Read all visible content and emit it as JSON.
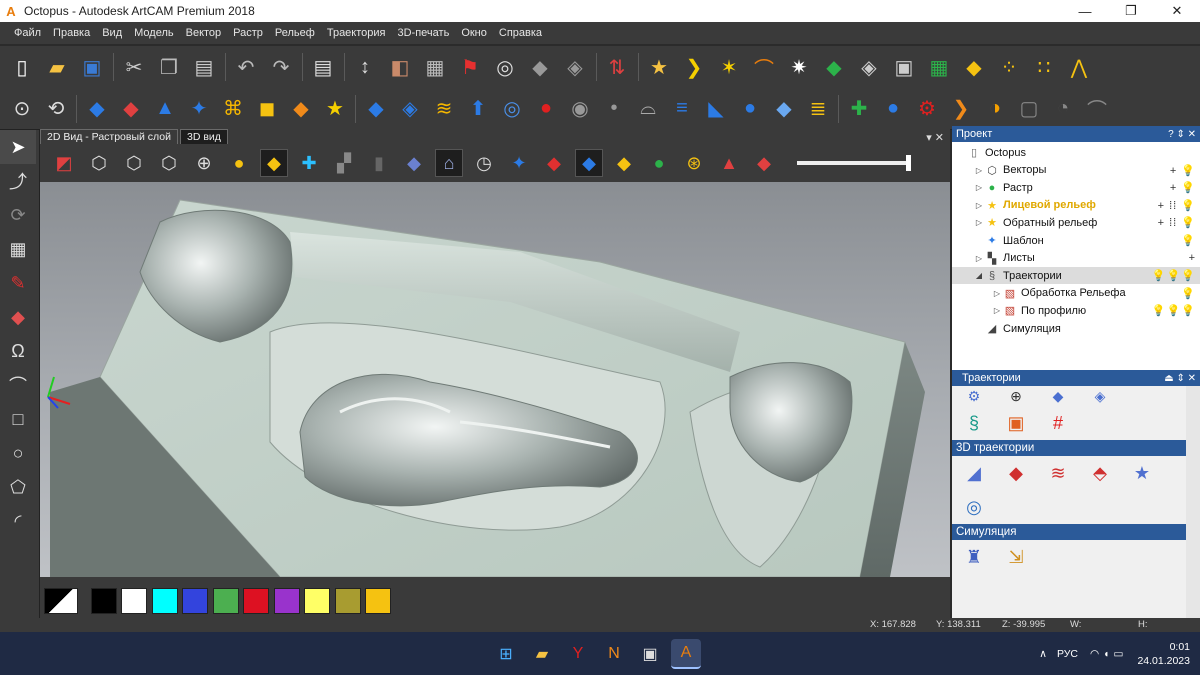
{
  "window": {
    "title": "Octopus - Autodesk ArtCAM Premium 2018",
    "logo_letter": "A",
    "minimize": "—",
    "maximize": "❐",
    "close": "✕"
  },
  "menu": [
    "Файл",
    "Правка",
    "Вид",
    "Модель",
    "Вектор",
    "Растр",
    "Рельеф",
    "Траектория",
    "3D-печать",
    "Окно",
    "Справка"
  ],
  "toolbar1_icons": [
    "new-file-icon",
    "open-folder-icon",
    "save-icon",
    "cut-icon",
    "copy-icon",
    "paste-icon",
    "undo-icon",
    "redo-icon",
    "notes-icon",
    "dimension-icon",
    "split-view-icon",
    "grid-view-icon",
    "flag-icon",
    "measure-icon",
    "fill-icon",
    "relief-icon",
    "distribute-icon",
    "folder-star-icon",
    "path-icon",
    "sparkle-icon",
    "curve-icon",
    "star-burst-icon",
    "green-tile-icon",
    "blend-icon",
    "frame-icon",
    "green-grid-icon",
    "yellow-tile-icon",
    "dots-icon",
    "dotted-line-icon",
    "node-chain-icon"
  ],
  "toolbar2_icons": [
    "zoom-fit-icon",
    "rotate-icon",
    "blue-diamond-icon",
    "red-tile-icon",
    "blue-pyramid-icon",
    "blue-star-icon",
    "gold-weave-icon",
    "yellow-box-icon",
    "orange-dots-icon",
    "star-page-icon",
    "blue-plane-icon",
    "blue-split-icon",
    "gold-stripes-icon",
    "blue-arrow-icon",
    "blue-target-icon",
    "red-button-icon",
    "gray-disc-icon",
    "gray-dot-icon",
    "gray-cup-icon",
    "blue-stack-icon",
    "blue-tilt-icon",
    "blue-ball-icon",
    "blue-flat-icon",
    "layer-stack-icon",
    "green-plus-icon",
    "blue-pot-icon",
    "red-gear-icon",
    "orange-arc-icon",
    "half-moon-icon",
    "gray-square-icon",
    "gray-crescent-icon",
    "gray-swoosh-icon"
  ],
  "left_tools": [
    "select-arrow-icon",
    "node-edit-icon",
    "transform-icon",
    "mesh-icon",
    "pen-icon",
    "eraser-icon",
    "text-tool-icon",
    "polyline-icon",
    "rectangle-icon",
    "circle-icon",
    "pentagon-icon",
    "arc-icon"
  ],
  "tabs": [
    "2D Вид - Растровый слой",
    "3D вид"
  ],
  "tab_controls": "▾  ✕",
  "view_tools": [
    "cube-iso-icon",
    "cube-front-icon",
    "cube-side-icon",
    "cube-top-icon",
    "zoom-icon",
    "light-bulb-icon",
    "shade-icon",
    "axes-icon",
    "puzzle-icon",
    "cylinder-icon",
    "blue-block-icon",
    "tool-icon",
    "clock-icon",
    "blue-star-icon",
    "red-blue-layer-icon",
    "blue-red-layer-icon",
    "yellow-layer-icon",
    "green-shapes-icon",
    "search-star-icon",
    "color-pyramid-icon",
    "color-stack-icon"
  ],
  "palette": {
    "colors": [
      "#000000",
      "#ffffff",
      "#00ffff",
      "#3344dd",
      "#4caf50",
      "#dd1122",
      "#9933cc",
      "#ffff66",
      "#a89c30",
      "#f5c211"
    ]
  },
  "status": {
    "x": "X: 167.828",
    "y": "Y: 138.311",
    "z": "Z: -39.995",
    "w": "W:",
    "h": "H:"
  },
  "project_panel": {
    "title": "Проект",
    "controls": "? ⇕ ✕",
    "items": [
      {
        "label": "Octopus",
        "icon": "document-icon",
        "arrow": "",
        "indent": 0,
        "actions": ""
      },
      {
        "label": "Векторы",
        "icon": "vector-icon",
        "arrow": "▷",
        "indent": 1,
        "actions": "+ 💡"
      },
      {
        "label": "Растр",
        "icon": "raster-icon",
        "arrow": "▷",
        "indent": 1,
        "actions": "+ 💡"
      },
      {
        "label": "Лицевой рельеф",
        "icon": "star-icon",
        "arrow": "▷",
        "indent": 1,
        "actions": "+ ⁞⁞ 💡"
      },
      {
        "label": "Обратный рельеф",
        "icon": "star-icon",
        "arrow": "▷",
        "indent": 1,
        "actions": "+ ⁞⁞ 💡"
      },
      {
        "label": "Шаблон",
        "icon": "blue-star-icon",
        "arrow": "",
        "indent": 1,
        "actions": "💡"
      },
      {
        "label": "Листы",
        "icon": "sheets-icon",
        "arrow": "▷",
        "indent": 1,
        "actions": "+"
      },
      {
        "label": "Траектории",
        "icon": "toolpath-icon",
        "arrow": "◢",
        "indent": 1,
        "actions": "💡💡💡"
      },
      {
        "label": "Обработка Рельефа",
        "icon": "hatch-icon",
        "arrow": "▷",
        "indent": 2,
        "actions": "💡"
      },
      {
        "label": "По профилю",
        "icon": "hatch-icon",
        "arrow": "▷",
        "indent": 2,
        "actions": "💡💡💡"
      },
      {
        "label": "Симуляция",
        "icon": "simulation-icon",
        "arrow": "",
        "indent": 1,
        "actions": ""
      }
    ]
  },
  "toolpaths_panel": {
    "title": "Траектории",
    "controls": "⏏ ⇕ ✕",
    "section_3d": "3D траектории",
    "section_sim": "Симуляция"
  },
  "taskbar": {
    "apps": [
      "windows-start-icon",
      "file-explorer-icon",
      "yandex-browser-icon",
      "notepad-icon",
      "image-app-icon",
      "artcam-icon"
    ],
    "lang": "РУС",
    "time": "0:01",
    "date": "24.01.2023"
  }
}
